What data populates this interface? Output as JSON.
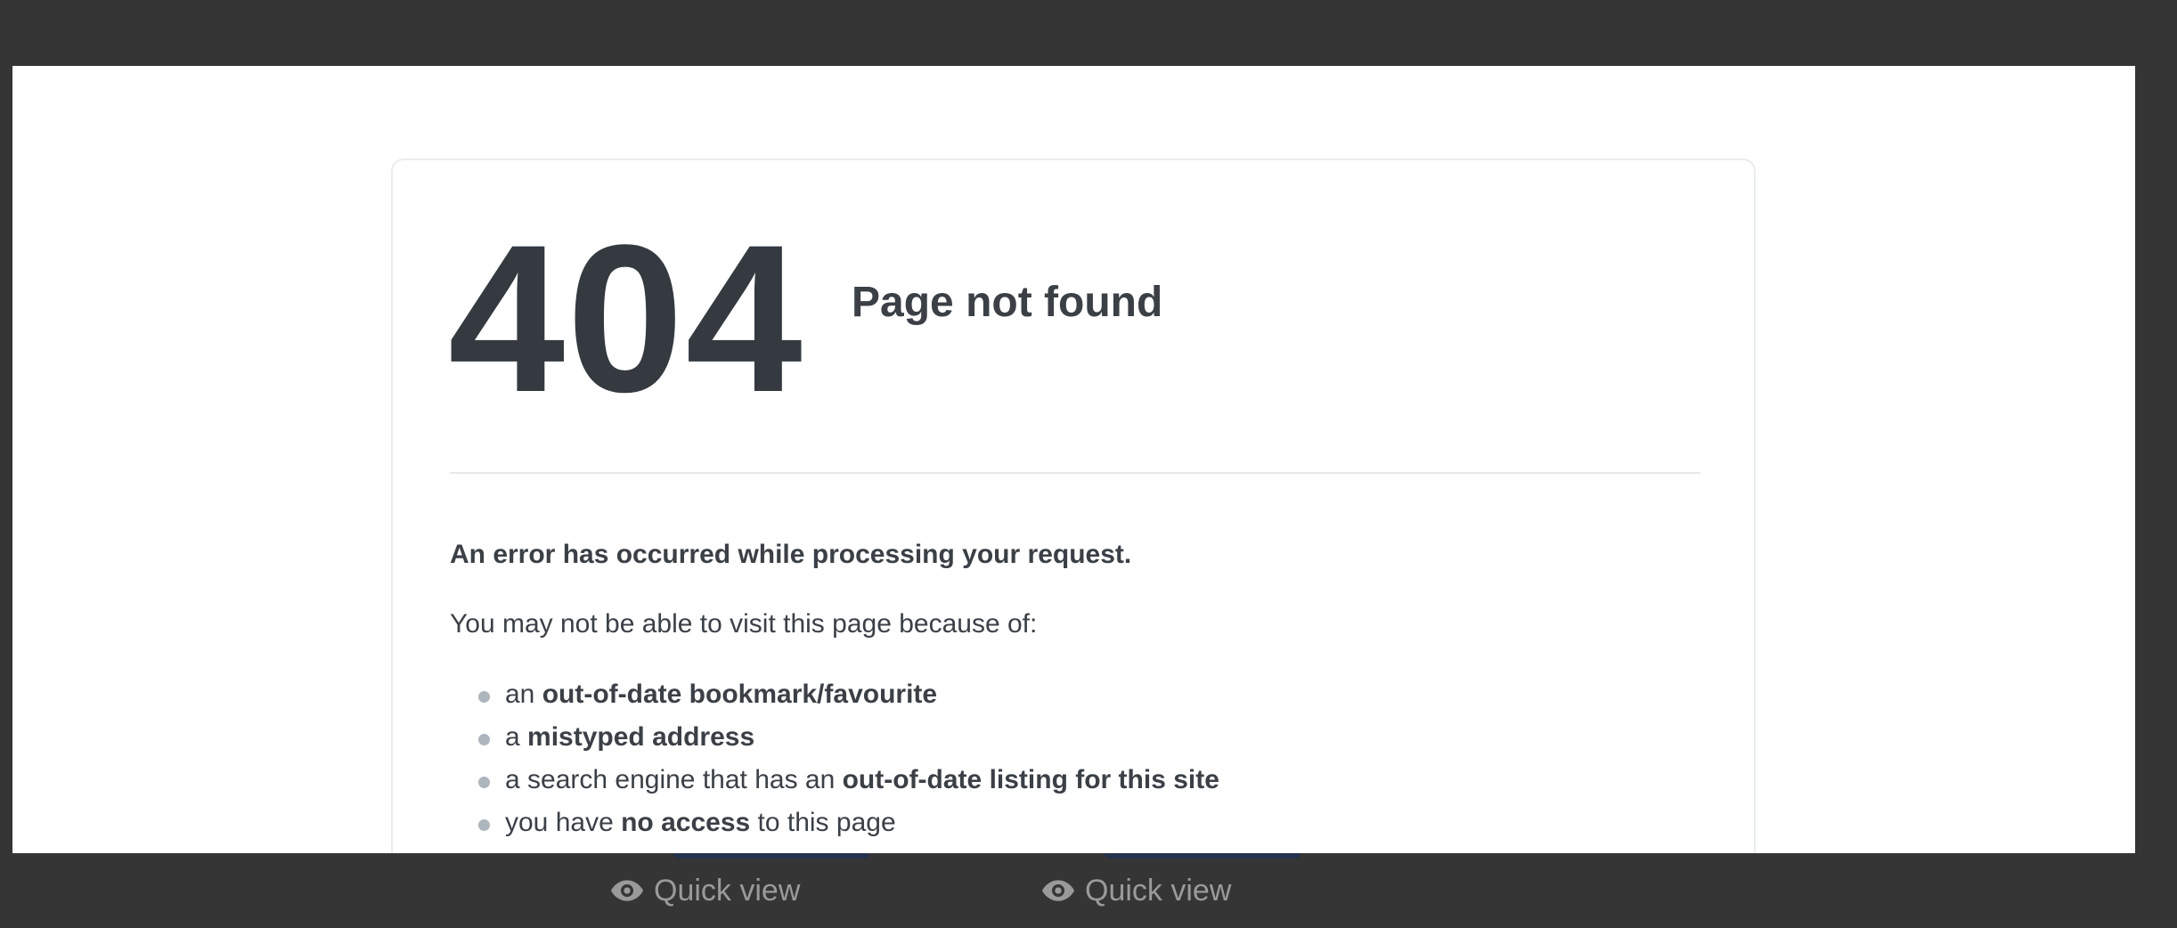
{
  "error": {
    "code": "404",
    "title": "Page not found",
    "intro": "An error has occurred while processing your request.",
    "reason_heading": "You may not be able to visit this page because of:",
    "reasons": [
      {
        "pre": "an ",
        "bold": "out-of-date bookmark/favourite",
        "post": ""
      },
      {
        "pre": "a ",
        "bold": "mistyped address",
        "post": ""
      },
      {
        "pre": "a search engine that has an ",
        "bold": "out-of-date listing for this site",
        "post": ""
      },
      {
        "pre": "you have ",
        "bold": "no access",
        "post": " to this page"
      }
    ]
  },
  "background": {
    "quick_view_items": [
      {
        "label": "Quick view",
        "icon": "eye-icon"
      },
      {
        "label": "Quick view",
        "icon": "eye-icon"
      }
    ]
  },
  "colors": {
    "backdrop": "#353535",
    "heading": "#343a40",
    "text": "#3b4047",
    "bullet": "#adb5bd",
    "bg_button": "#24324f"
  }
}
